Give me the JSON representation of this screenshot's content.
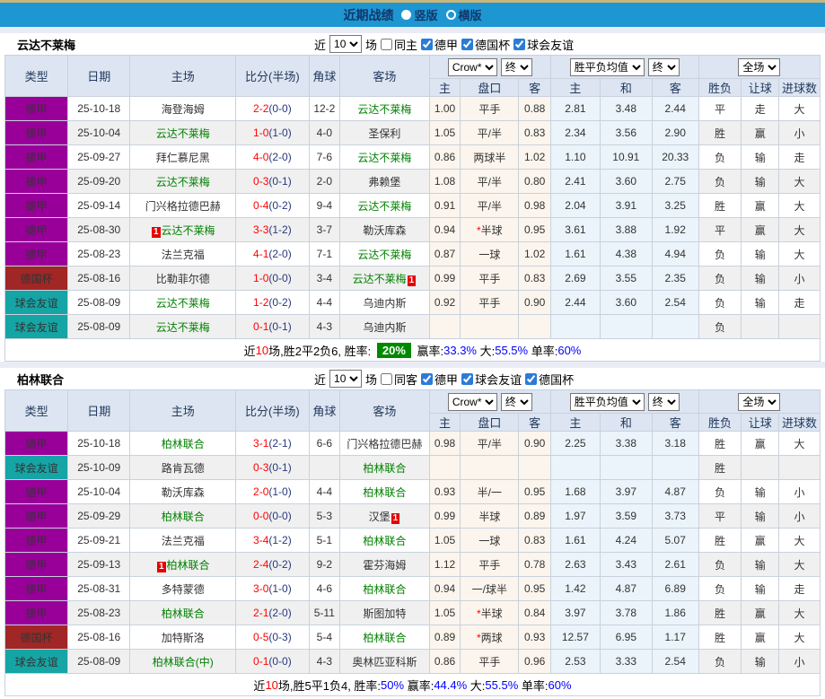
{
  "title_bar": {
    "title": "近期战绩",
    "view_options": [
      {
        "label": "竖版",
        "selected": true
      },
      {
        "label": "横版",
        "selected": false
      }
    ]
  },
  "table_header": {
    "main_columns": [
      "类型",
      "日期",
      "主场",
      "比分(半场)",
      "角球",
      "客场"
    ],
    "odds_select": "Crow*",
    "odds_final_select": "终",
    "avg_select": "胜平负均值",
    "avg_final_select": "终",
    "scope_select": "全场",
    "sub_columns": [
      "主",
      "盘口",
      "客",
      "主",
      "和",
      "客",
      "胜负",
      "让球",
      "进球数"
    ]
  },
  "colors": {
    "titlebar_blue": "#1E96D2",
    "league_badge_purple": "#990099",
    "cup_badge_darkred": "#A12626",
    "friendly_badge_teal": "#16A5A5",
    "win_red": "#E60000",
    "draw_blue": "#2929D6",
    "lose_green": "#008000",
    "winrate_badge_green": "#008800"
  },
  "sections": [
    {
      "team": "云达不莱梅",
      "filter": {
        "prefix": "近",
        "count": "10",
        "suffix": "场",
        "same": {
          "label": "同主",
          "checked": false
        },
        "leagues": [
          {
            "label": "德甲",
            "checked": true
          },
          {
            "label": "德国杯",
            "checked": true
          },
          {
            "label": "球会友谊",
            "checked": true
          }
        ]
      },
      "rows": [
        {
          "type": "德甲",
          "date": "25-10-18",
          "home": {
            "name": "海登海姆",
            "focus": false
          },
          "score": "2-2",
          "half": "(0-0)",
          "corner": "12-2",
          "away": {
            "name": "云达不莱梅",
            "focus": true
          },
          "odds": [
            "1.00",
            "平手",
            "0.88",
            "2.81",
            "3.48",
            "2.44"
          ],
          "results": [
            "平",
            "走",
            "大"
          ]
        },
        {
          "type": "德甲",
          "date": "25-10-04",
          "home": {
            "name": "云达不莱梅",
            "focus": true
          },
          "score": "1-0",
          "half": "(1-0)",
          "corner": "4-0",
          "away": {
            "name": "圣保利",
            "focus": false
          },
          "odds": [
            "1.05",
            "平/半",
            "0.83",
            "2.34",
            "3.56",
            "2.90"
          ],
          "results": [
            "胜",
            "赢",
            "小"
          ]
        },
        {
          "type": "德甲",
          "date": "25-09-27",
          "home": {
            "name": "拜仁慕尼黑",
            "focus": false
          },
          "score": "4-0",
          "half": "(2-0)",
          "corner": "7-6",
          "away": {
            "name": "云达不莱梅",
            "focus": true
          },
          "odds": [
            "0.86",
            "两球半",
            "1.02",
            "1.10",
            "10.91",
            "20.33"
          ],
          "results": [
            "负",
            "输",
            "走"
          ]
        },
        {
          "type": "德甲",
          "date": "25-09-20",
          "home": {
            "name": "云达不莱梅",
            "focus": true
          },
          "score": "0-3",
          "half": "(0-1)",
          "corner": "2-0",
          "away": {
            "name": "弗赖堡",
            "focus": false
          },
          "odds": [
            "1.08",
            "平/半",
            "0.80",
            "2.41",
            "3.60",
            "2.75"
          ],
          "results": [
            "负",
            "输",
            "大"
          ]
        },
        {
          "type": "德甲",
          "date": "25-09-14",
          "home": {
            "name": "门兴格拉德巴赫",
            "focus": false
          },
          "score": "0-4",
          "half": "(0-2)",
          "corner": "9-4",
          "away": {
            "name": "云达不莱梅",
            "focus": true
          },
          "odds": [
            "0.91",
            "平/半",
            "0.98",
            "2.04",
            "3.91",
            "3.25"
          ],
          "results": [
            "胜",
            "赢",
            "大"
          ]
        },
        {
          "type": "德甲",
          "date": "25-08-30",
          "home": {
            "name": "云达不莱梅",
            "focus": true,
            "badge_pre": "1"
          },
          "score": "3-3",
          "half": "(1-2)",
          "corner": "3-7",
          "away": {
            "name": "勒沃库森",
            "focus": false
          },
          "odds": [
            "0.94",
            "*半球",
            "0.95",
            "3.61",
            "3.88",
            "1.92"
          ],
          "results": [
            "平",
            "赢",
            "大"
          ]
        },
        {
          "type": "德甲",
          "date": "25-08-23",
          "home": {
            "name": "法兰克福",
            "focus": false
          },
          "score": "4-1",
          "half": "(2-0)",
          "corner": "7-1",
          "away": {
            "name": "云达不莱梅",
            "focus": true
          },
          "odds": [
            "0.87",
            "一球",
            "1.02",
            "1.61",
            "4.38",
            "4.94"
          ],
          "results": [
            "负",
            "输",
            "大"
          ]
        },
        {
          "type": "德国杯",
          "date": "25-08-16",
          "home": {
            "name": "比勒菲尔德",
            "focus": false
          },
          "score": "1-0",
          "half": "(0-0)",
          "corner": "3-4",
          "away": {
            "name": "云达不莱梅",
            "focus": true,
            "badge_post": "1"
          },
          "odds": [
            "0.99",
            "平手",
            "0.83",
            "2.69",
            "3.55",
            "2.35"
          ],
          "results": [
            "负",
            "输",
            "小"
          ]
        },
        {
          "type": "球会友谊",
          "date": "25-08-09",
          "home": {
            "name": "云达不莱梅",
            "focus": true
          },
          "score": "1-2",
          "half": "(0-2)",
          "corner": "4-4",
          "away": {
            "name": "乌迪内斯",
            "focus": false
          },
          "odds": [
            "0.92",
            "平手",
            "0.90",
            "2.44",
            "3.60",
            "2.54"
          ],
          "results": [
            "负",
            "输",
            "走"
          ]
        },
        {
          "type": "球会友谊",
          "date": "25-08-09",
          "home": {
            "name": "云达不莱梅",
            "focus": true
          },
          "score": "0-1",
          "half": "(0-1)",
          "corner": "4-3",
          "away": {
            "name": "乌迪内斯",
            "focus": false
          },
          "odds": [
            "",
            "",
            "",
            "",
            "",
            ""
          ],
          "results": [
            "负",
            "",
            ""
          ]
        }
      ],
      "summary": [
        {
          "text": "近",
          "style": "plain"
        },
        {
          "text": "10",
          "style": "red"
        },
        {
          "text": "场,胜2平2负6, 胜率: ",
          "style": "plain"
        },
        {
          "text": "20%",
          "style": "green-badge"
        },
        {
          "text": " 赢率:",
          "style": "plain"
        },
        {
          "text": "33.3%",
          "style": "blue"
        },
        {
          "text": " 大:",
          "style": "plain"
        },
        {
          "text": "55.5%",
          "style": "blue"
        },
        {
          "text": " 单率:",
          "style": "plain"
        },
        {
          "text": "60%",
          "style": "blue"
        }
      ]
    },
    {
      "team": "柏林联合",
      "filter": {
        "prefix": "近",
        "count": "10",
        "suffix": "场",
        "same": {
          "label": "同客",
          "checked": false
        },
        "leagues": [
          {
            "label": "德甲",
            "checked": true
          },
          {
            "label": "球会友谊",
            "checked": true
          },
          {
            "label": "德国杯",
            "checked": true
          }
        ]
      },
      "rows": [
        {
          "type": "德甲",
          "date": "25-10-18",
          "home": {
            "name": "柏林联合",
            "focus": true
          },
          "score": "3-1",
          "half": "(2-1)",
          "corner": "6-6",
          "away": {
            "name": "门兴格拉德巴赫",
            "focus": false
          },
          "odds": [
            "0.98",
            "平/半",
            "0.90",
            "2.25",
            "3.38",
            "3.18"
          ],
          "results": [
            "胜",
            "赢",
            "大"
          ]
        },
        {
          "type": "球会友谊",
          "date": "25-10-09",
          "home": {
            "name": "路肯瓦德",
            "focus": false
          },
          "score": "0-3",
          "half": "(0-1)",
          "corner": "",
          "away": {
            "name": "柏林联合",
            "focus": true
          },
          "odds": [
            "",
            "",
            "",
            "",
            "",
            ""
          ],
          "results": [
            "胜",
            "",
            ""
          ]
        },
        {
          "type": "德甲",
          "date": "25-10-04",
          "home": {
            "name": "勒沃库森",
            "focus": false
          },
          "score": "2-0",
          "half": "(1-0)",
          "corner": "4-4",
          "away": {
            "name": "柏林联合",
            "focus": true
          },
          "odds": [
            "0.93",
            "半/一",
            "0.95",
            "1.68",
            "3.97",
            "4.87"
          ],
          "results": [
            "负",
            "输",
            "小"
          ]
        },
        {
          "type": "德甲",
          "date": "25-09-29",
          "home": {
            "name": "柏林联合",
            "focus": true
          },
          "score": "0-0",
          "half": "(0-0)",
          "corner": "5-3",
          "away": {
            "name": "汉堡",
            "focus": false,
            "badge_post": "1"
          },
          "odds": [
            "0.99",
            "半球",
            "0.89",
            "1.97",
            "3.59",
            "3.73"
          ],
          "results": [
            "平",
            "输",
            "小"
          ]
        },
        {
          "type": "德甲",
          "date": "25-09-21",
          "home": {
            "name": "法兰克福",
            "focus": false
          },
          "score": "3-4",
          "half": "(1-2)",
          "corner": "5-1",
          "away": {
            "name": "柏林联合",
            "focus": true
          },
          "odds": [
            "1.05",
            "一球",
            "0.83",
            "1.61",
            "4.24",
            "5.07"
          ],
          "results": [
            "胜",
            "赢",
            "大"
          ]
        },
        {
          "type": "德甲",
          "date": "25-09-13",
          "home": {
            "name": "柏林联合",
            "focus": true,
            "badge_pre": "1"
          },
          "score": "2-4",
          "half": "(0-2)",
          "corner": "9-2",
          "away": {
            "name": "霍芬海姆",
            "focus": false
          },
          "odds": [
            "1.12",
            "平手",
            "0.78",
            "2.63",
            "3.43",
            "2.61"
          ],
          "results": [
            "负",
            "输",
            "大"
          ]
        },
        {
          "type": "德甲",
          "date": "25-08-31",
          "home": {
            "name": "多特蒙德",
            "focus": false
          },
          "score": "3-0",
          "half": "(1-0)",
          "corner": "4-6",
          "away": {
            "name": "柏林联合",
            "focus": true
          },
          "odds": [
            "0.94",
            "一/球半",
            "0.95",
            "1.42",
            "4.87",
            "6.89"
          ],
          "results": [
            "负",
            "输",
            "走"
          ]
        },
        {
          "type": "德甲",
          "date": "25-08-23",
          "home": {
            "name": "柏林联合",
            "focus": true
          },
          "score": "2-1",
          "half": "(2-0)",
          "corner": "5-11",
          "away": {
            "name": "斯图加特",
            "focus": false
          },
          "odds": [
            "1.05",
            "*半球",
            "0.84",
            "3.97",
            "3.78",
            "1.86"
          ],
          "results": [
            "胜",
            "赢",
            "大"
          ]
        },
        {
          "type": "德国杯",
          "date": "25-08-16",
          "home": {
            "name": "加特斯洛",
            "focus": false
          },
          "score": "0-5",
          "half": "(0-3)",
          "corner": "5-4",
          "away": {
            "name": "柏林联合",
            "focus": true
          },
          "odds": [
            "0.89",
            "*两球",
            "0.93",
            "12.57",
            "6.95",
            "1.17"
          ],
          "results": [
            "胜",
            "赢",
            "大"
          ]
        },
        {
          "type": "球会友谊",
          "date": "25-08-09",
          "home": {
            "name": "柏林联合(中)",
            "focus": true
          },
          "score": "0-1",
          "half": "(0-0)",
          "corner": "4-3",
          "away": {
            "name": "奥林匹亚科斯",
            "focus": false
          },
          "odds": [
            "0.86",
            "平手",
            "0.96",
            "2.53",
            "3.33",
            "2.54"
          ],
          "results": [
            "负",
            "输",
            "小"
          ]
        }
      ],
      "summary": [
        {
          "text": "近",
          "style": "plain"
        },
        {
          "text": "10",
          "style": "red"
        },
        {
          "text": "场,胜5平1负4, 胜率:",
          "style": "plain"
        },
        {
          "text": "50%",
          "style": "blue"
        },
        {
          "text": " 赢率:",
          "style": "plain"
        },
        {
          "text": "44.4%",
          "style": "blue"
        },
        {
          "text": " 大:",
          "style": "plain"
        },
        {
          "text": "55.5%",
          "style": "blue"
        },
        {
          "text": " 单率:",
          "style": "plain"
        },
        {
          "text": "60%",
          "style": "blue"
        }
      ]
    }
  ]
}
